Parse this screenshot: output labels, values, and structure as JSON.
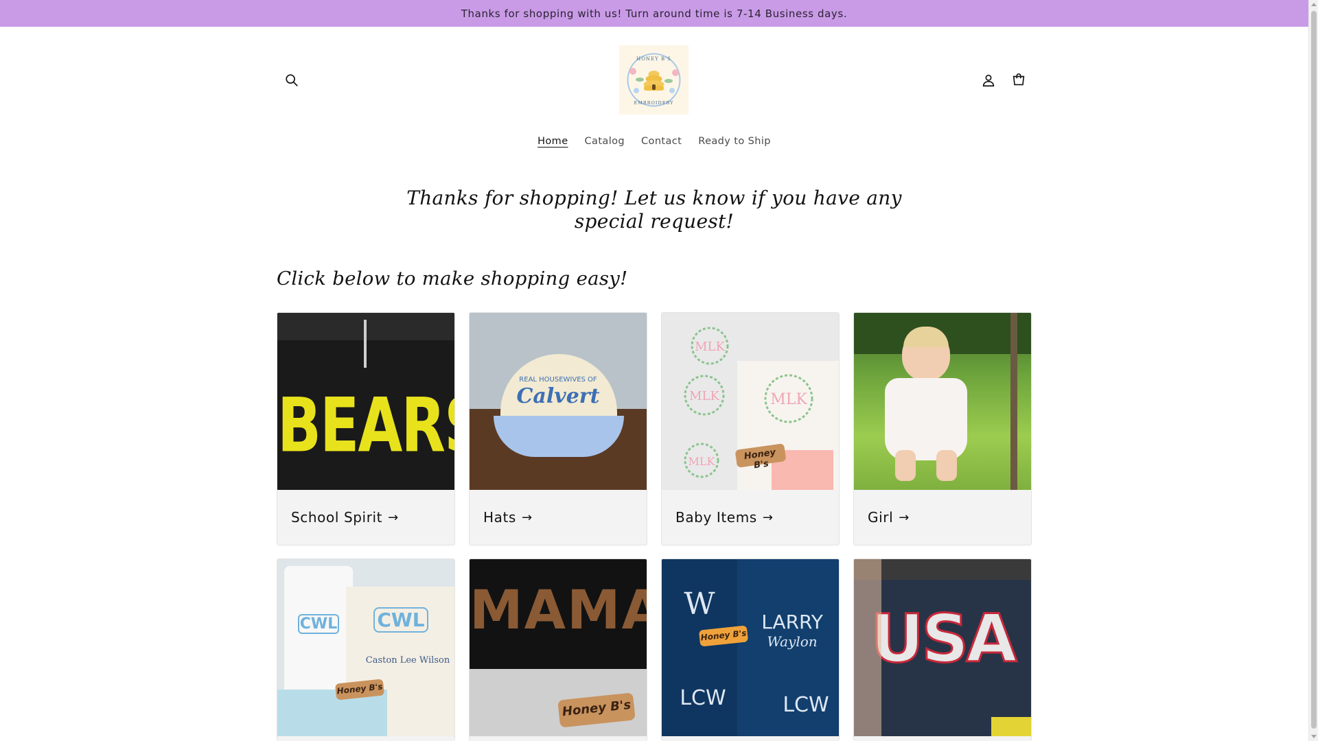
{
  "announcement": "Thanks for shopping with us! Turn around time is 7-14 Business days.",
  "logo": {
    "text_top": "HONEY B'S",
    "text_bottom": "EMBROIDERY",
    "icon": "beehive-logo"
  },
  "header": {
    "search_icon": "search-icon",
    "account_icon": "account-icon",
    "cart_icon": "cart-icon"
  },
  "nav": {
    "home": "Home",
    "catalog": "Catalog",
    "contact": "Contact",
    "ready_to_ship": "Ready to Ship"
  },
  "hero": {
    "text": "Thanks for shopping! Let us know if you have any special request!"
  },
  "collections": {
    "title": "Click below to make shopping easy!",
    "arrow": "→",
    "cards": [
      {
        "label": "School Spirit",
        "image_text": "BEARS"
      },
      {
        "label": "Hats",
        "image_text_top": "REAL HOUSEWIVES OF",
        "image_text": "Calvert"
      },
      {
        "label": "Baby Items",
        "image_text": "Honey B's"
      },
      {
        "label": "Girl",
        "image_text": ""
      },
      {
        "label": "",
        "image_text": "CWL",
        "image_text_sub": "Caston Lee Wilson",
        "badge": "Honey B's"
      },
      {
        "label": "",
        "image_text": "MAMA",
        "badge": "Honey B's"
      },
      {
        "label": "",
        "image_text": "W",
        "image_text_sub": "LARRY",
        "image_text_sub2": "Waylon",
        "image_text_sub3": "LCW",
        "badge": "Honey B's"
      },
      {
        "label": "",
        "image_text": "USA"
      }
    ]
  },
  "colors": {
    "announcement_bg": "#c99be6",
    "card_bg": "#f3f3f3"
  }
}
